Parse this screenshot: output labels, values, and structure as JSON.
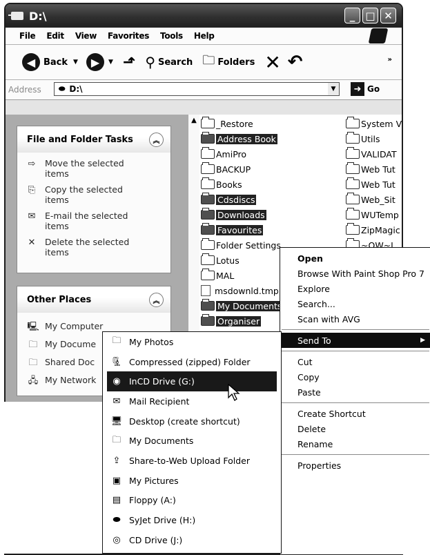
{
  "window": {
    "title": "D:\\"
  },
  "menu": [
    "File",
    "Edit",
    "View",
    "Favorites",
    "Tools",
    "Help"
  ],
  "toolbar": {
    "back": "Back",
    "search": "Search",
    "folders": "Folders"
  },
  "address": {
    "label": "Address",
    "value": "D:\\",
    "go": "Go"
  },
  "tasks": {
    "title": "File and Folder Tasks",
    "items": [
      "Move the selected items",
      "Copy the selected items",
      "E-mail the selected items",
      "Delete the selected items"
    ]
  },
  "places": {
    "title": "Other Places",
    "items": [
      "My Computer",
      "My Docume",
      "Shared Doc",
      "My Network"
    ]
  },
  "files_col1": [
    {
      "name": "_Restore",
      "sel": false
    },
    {
      "name": "Address Book",
      "sel": true
    },
    {
      "name": "AmiPro",
      "sel": false
    },
    {
      "name": "BACKUP",
      "sel": false
    },
    {
      "name": "Books",
      "sel": false
    },
    {
      "name": "Cdsdiscs",
      "sel": true
    },
    {
      "name": "Downloads",
      "sel": true
    },
    {
      "name": "Favourites",
      "sel": true
    },
    {
      "name": "Folder Settings",
      "sel": false
    },
    {
      "name": "Lotus",
      "sel": false
    },
    {
      "name": "MAL",
      "sel": false
    },
    {
      "name": "msdownld.tmp",
      "sel": false
    },
    {
      "name": "My Documents",
      "sel": true
    },
    {
      "name": "Organiser",
      "sel": true
    }
  ],
  "files_col2": [
    "System V",
    "Utils",
    "VALIDAT",
    "Web Tut",
    "Web Tut",
    "Web_Sit",
    "WUTemp",
    "ZipMagic",
    "~OW~L"
  ],
  "context_menu": {
    "items": [
      "Open",
      "Browse With Paint Shop Pro 7",
      "Explore",
      "Search...",
      "Scan with AVG"
    ],
    "send_to": "Send To",
    "edit": [
      "Cut",
      "Copy",
      "Paste"
    ],
    "more": [
      "Create Shortcut",
      "Delete",
      "Rename"
    ],
    "properties": "Properties"
  },
  "send_to_menu": [
    {
      "label": "My Photos",
      "icon": "folder-icon"
    },
    {
      "label": "Compressed (zipped) Folder",
      "icon": "zip-folder-icon"
    },
    {
      "label": "InCD Drive (G:)",
      "icon": "cd-drive-icon"
    },
    {
      "label": "Mail Recipient",
      "icon": "mail-icon"
    },
    {
      "label": "Desktop (create shortcut)",
      "icon": "desktop-icon"
    },
    {
      "label": "My Documents",
      "icon": "documents-icon"
    },
    {
      "label": "Share-to-Web Upload Folder",
      "icon": "web-upload-icon"
    },
    {
      "label": "My Pictures",
      "icon": "pictures-icon"
    },
    {
      "label": "Floppy (A:)",
      "icon": "floppy-icon"
    },
    {
      "label": "SyJet Drive (H:)",
      "icon": "drive-icon"
    },
    {
      "label": "CD Drive (J:)",
      "icon": "cd-icon"
    }
  ]
}
